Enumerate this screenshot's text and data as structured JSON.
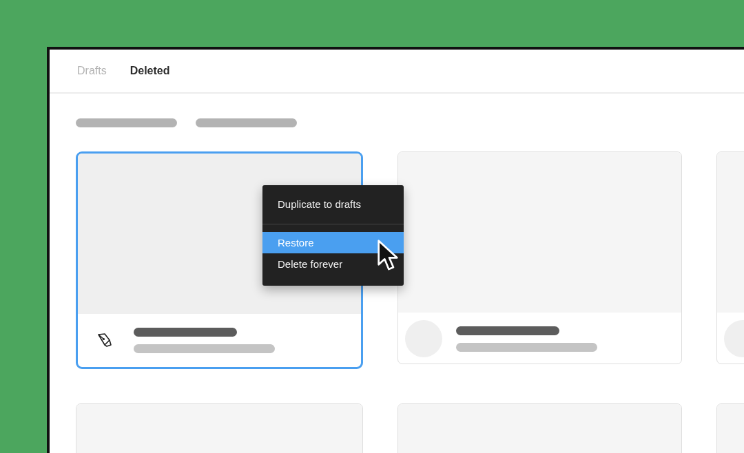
{
  "tabs": [
    {
      "label": "Drafts",
      "selected": false
    },
    {
      "label": "Deleted",
      "selected": true
    }
  ],
  "cards": [
    {
      "selected": true,
      "kind": "pen"
    },
    {
      "selected": false,
      "kind": "avatar"
    },
    {
      "selected": false,
      "kind": "avatar-edge"
    },
    {
      "selected": false
    },
    {
      "selected": false
    },
    {
      "selected": false
    }
  ],
  "context_menu": {
    "items": [
      {
        "kind": "item",
        "label": "Duplicate to drafts",
        "selected": false
      },
      {
        "kind": "separator"
      },
      {
        "kind": "item",
        "label": "Restore",
        "selected": true
      },
      {
        "kind": "item",
        "label": "Delete forever",
        "selected": false
      }
    ]
  }
}
